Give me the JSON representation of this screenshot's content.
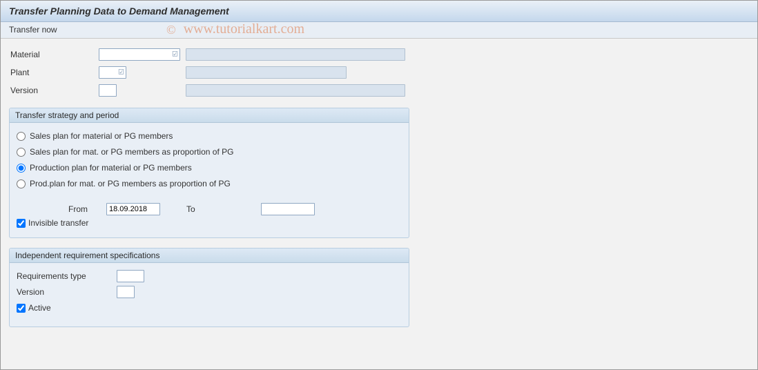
{
  "header": {
    "title": "Transfer Planning Data to Demand Management"
  },
  "toolbar": {
    "transfer_now": "Transfer now"
  },
  "fields": {
    "material_label": "Material",
    "material_value": "",
    "plant_label": "Plant",
    "plant_value": "",
    "version_label": "Version",
    "version_value": ""
  },
  "group_strategy": {
    "title": "Transfer strategy and period",
    "radios": {
      "opt1": "Sales plan for material or PG members",
      "opt2": "Sales plan for mat. or PG members as proportion of PG",
      "opt3": "Production plan for material or PG members",
      "opt4": "Prod.plan for mat. or PG members as proportion of PG"
    },
    "selected": "opt3",
    "from_label": "From",
    "from_value": "18.09.2018",
    "to_label": "To",
    "to_value": "",
    "invisible_label": "Invisible transfer",
    "invisible_checked": true
  },
  "group_spec": {
    "title": "Independent requirement specifications",
    "reqtype_label": "Requirements type",
    "reqtype_value": "",
    "version_label": "Version",
    "version_value": "",
    "active_label": "Active",
    "active_checked": true
  },
  "watermark": "www.tutorialkart.com"
}
